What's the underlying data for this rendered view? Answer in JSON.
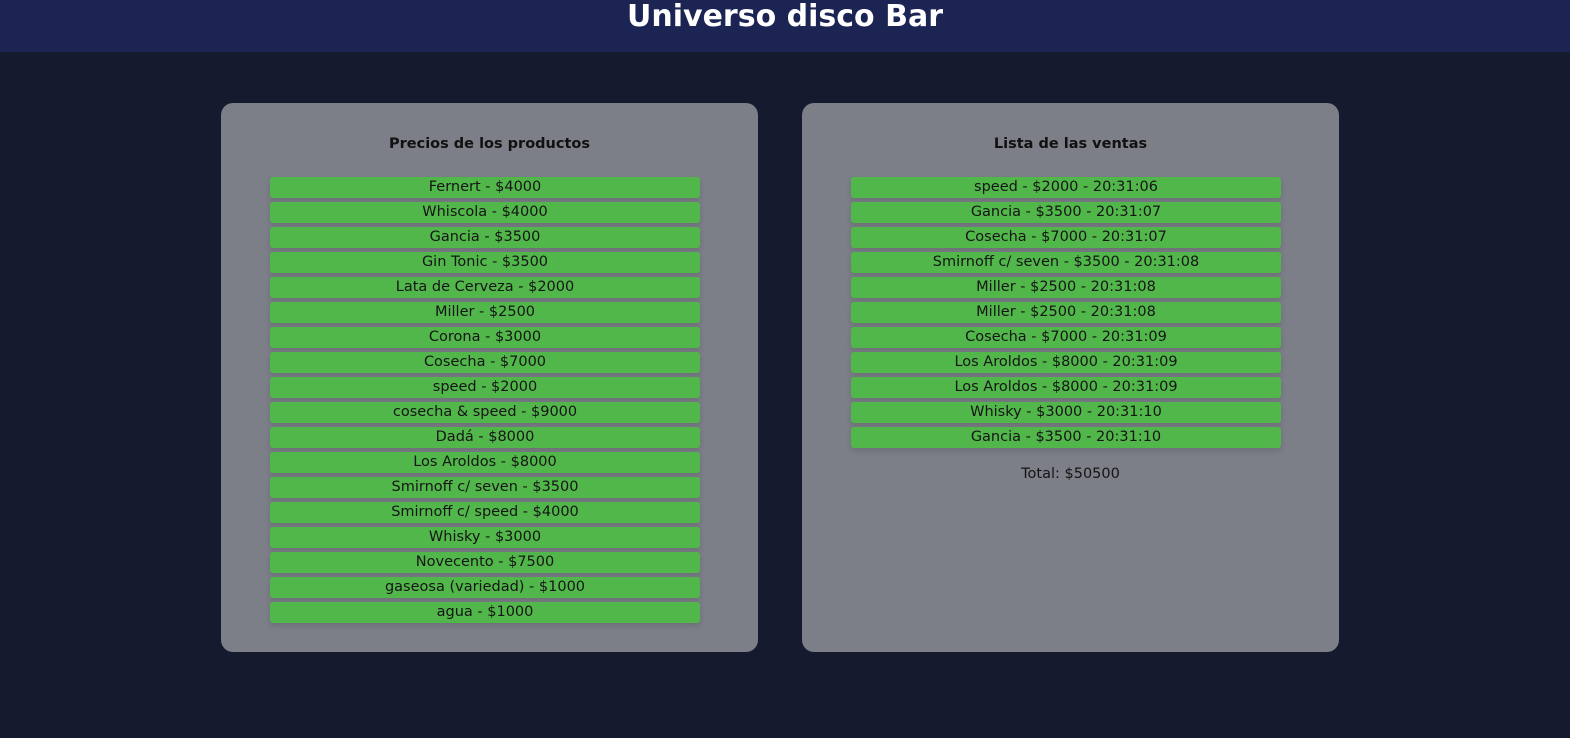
{
  "header": {
    "title": "Universo disco Bar"
  },
  "products": {
    "title": "Precios de los productos",
    "items": [
      "Fernert - $4000",
      "Whiscola - $4000",
      "Gancia - $3500",
      "Gin Tonic - $3500",
      "Lata de Cerveza - $2000",
      "Miller - $2500",
      "Corona - $3000",
      "Cosecha - $7000",
      "speed - $2000",
      "cosecha & speed - $9000",
      "Dadá - $8000",
      "Los Aroldos - $8000",
      "Smirnoff c/ seven - $3500",
      "Smirnoff c/ speed - $4000",
      "Whisky - $3000",
      "Novecento - $7500",
      "gaseosa (variedad) - $1000",
      "agua - $1000"
    ]
  },
  "sales": {
    "title": "Lista de las ventas",
    "items": [
      "speed - $2000 - 20:31:06",
      "Gancia - $3500 - 20:31:07",
      "Cosecha - $7000 - 20:31:07",
      "Smirnoff c/ seven - $3500 - 20:31:08",
      "Miller - $2500 - 20:31:08",
      "Miller - $2500 - 20:31:08",
      "Cosecha - $7000 - 20:31:09",
      "Los Aroldos - $8000 - 20:31:09",
      "Los Aroldos - $8000 - 20:31:09",
      "Whisky - $3000 - 20:31:10",
      "Gancia - $3500 - 20:31:10"
    ],
    "total": "Total: $50500"
  },
  "colors": {
    "background": "#161a2e",
    "header": "#1b2453",
    "panel": "#7c7e88",
    "item": "#52b74b"
  }
}
